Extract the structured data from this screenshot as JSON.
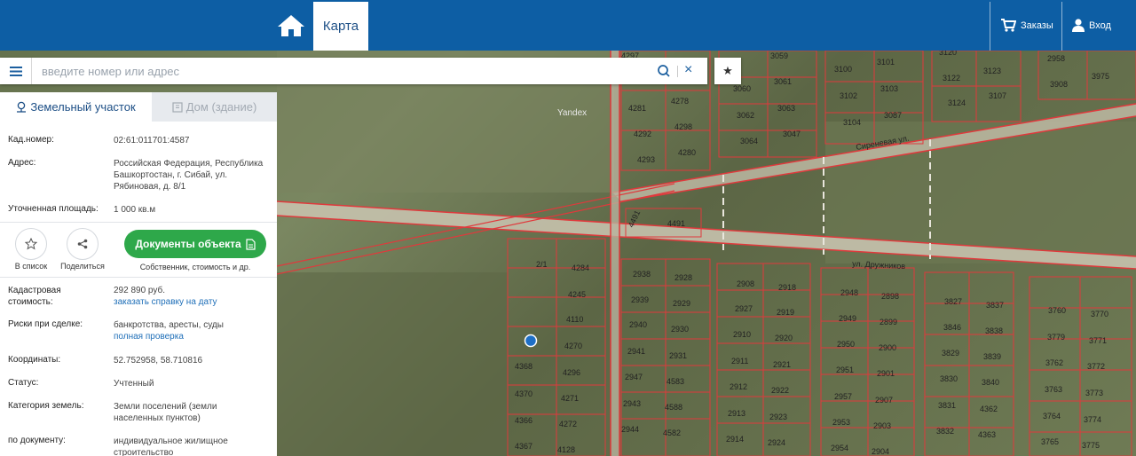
{
  "header": {
    "map_tab": "Карта",
    "orders": "Заказы",
    "login": "Вход",
    "icons": {
      "home": "home-icon",
      "cart": "cart-icon",
      "user": "user-icon"
    }
  },
  "search": {
    "placeholder": "введите номер или адрес",
    "value": ""
  },
  "panel": {
    "tab_land": "Земельный участок",
    "tab_house": "Дом (здание)",
    "cad_label": "Кад.номер:",
    "cad_value": "02:61:011701:4587",
    "address_label": "Адрес:",
    "address_value": "Российская Федерация, Республика Башкортостан, г. Сибай, ул. Рябиновая, д. 8/1",
    "area_label": "Уточненная площадь:",
    "area_value": "1 000 кв.м",
    "actions": {
      "favorite": "В список",
      "share": "Поделиться",
      "docs_button": "Документы объекта",
      "docs_sub": "Собственник, стоимость и др."
    },
    "cost_label": "Кадастровая стоимость:",
    "cost_value": "292 890 руб.",
    "cost_link": "заказать справку на дату",
    "risk_label": "Риски при сделке:",
    "risk_value": "банкротства, аресты, суды",
    "risk_link": "полная проверка",
    "coords_label": "Координаты:",
    "coords_value": "52.752958, 58.710816",
    "status_label": "Статус:",
    "status_value": "Учтенный",
    "category_label": "Категория земель:",
    "category_value": "Земли поселений (земли населенных пунктов)",
    "doc_label": "по документу:",
    "doc_value": "индивидуальное жилищное строительство"
  },
  "map": {
    "watermark": "Yandex",
    "streets": [
      "ул. Дружников",
      "Сиреневая ул."
    ],
    "lots_top": [
      "4297",
      "3059",
      "3100",
      "3101",
      "3120",
      "2958",
      "3975",
      "3060",
      "3061",
      "3122",
      "3123",
      "3908",
      "4281",
      "4278",
      "3102",
      "3103",
      "3124",
      "3107",
      "3062",
      "3063",
      "4292",
      "4298",
      "3104",
      "3087",
      "3064",
      "3047",
      "4293",
      "4280",
      "4491",
      "4491"
    ],
    "lots_bottom": [
      "2/1",
      "4284",
      "2938",
      "2928",
      "2908",
      "2918",
      "2948",
      "2898",
      "3827",
      "3837",
      "4245",
      "2939",
      "2929",
      "2927",
      "2919",
      "2949",
      "2899",
      "3846",
      "3838",
      "3760",
      "3770",
      "4110",
      "2940",
      "2930",
      "2910",
      "2920",
      "2950",
      "2900",
      "3829",
      "3839",
      "3779",
      "3771",
      "4270",
      "2941",
      "2931",
      "2911",
      "2921",
      "2951",
      "2901",
      "3830",
      "3840",
      "3762",
      "3772",
      "4368",
      "4296",
      "2947",
      "4583",
      "2912",
      "2922",
      "2957",
      "2907",
      "3831",
      "4362",
      "3763",
      "3773",
      "4370",
      "4271",
      "2943",
      "4588",
      "2913",
      "2923",
      "2953",
      "2903",
      "3832",
      "4363",
      "3764",
      "3774",
      "4366",
      "4272",
      "2944",
      "4582",
      "2914",
      "2924",
      "2954",
      "2904",
      "3765",
      "3775",
      "4367",
      "4128"
    ]
  }
}
